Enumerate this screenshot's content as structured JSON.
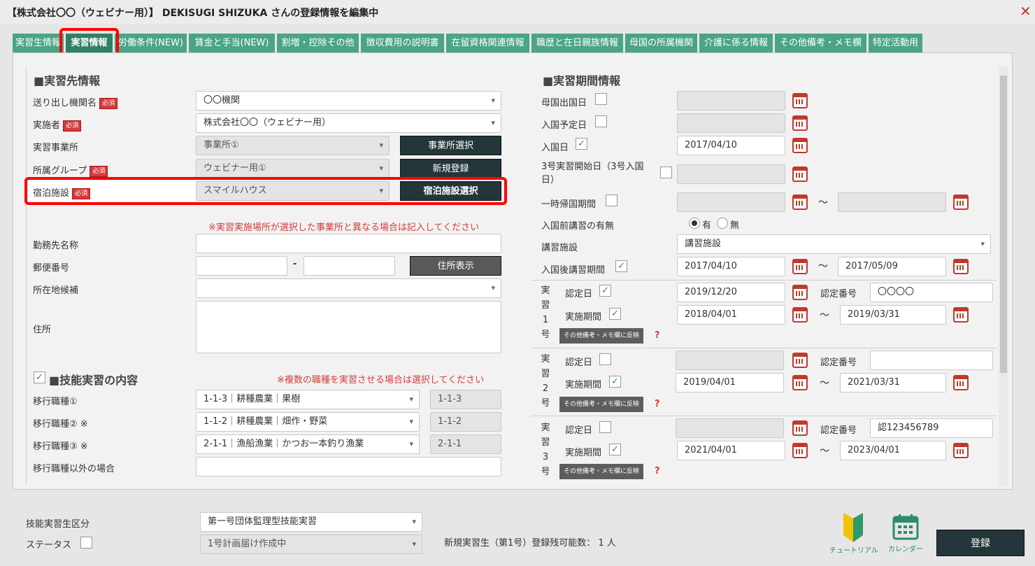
{
  "window": {
    "title": "【株式会社〇〇（ウェビナー用）】 DEKISUGI SHIZUKA さんの登録情報を編集中"
  },
  "tabs": [
    {
      "label": "実習生情報"
    },
    {
      "label": "実習情報"
    },
    {
      "label": "労働条件(NEW)"
    },
    {
      "label": "賃金と手当(NEW)"
    },
    {
      "label": "割増・控除その他"
    },
    {
      "label": "徴収費用の説明書"
    },
    {
      "label": "在留資格関連情報"
    },
    {
      "label": "職歴と在日親族情報"
    },
    {
      "label": "母国の所属機関"
    },
    {
      "label": "介護に係る情報"
    },
    {
      "label": "その他備考・メモ欄"
    },
    {
      "label": "特定活動用"
    }
  ],
  "left": {
    "section_title": "■実習先情報",
    "required_badge": "必須",
    "sending_org": {
      "label": "送り出し機関名",
      "value": "〇〇機関"
    },
    "implementer": {
      "label": "実施者",
      "value": "株式会社〇〇（ウェビナー用）"
    },
    "office": {
      "label": "実習事業所",
      "value": "事業所①",
      "button": "事業所選択"
    },
    "group": {
      "label": "所属グループ",
      "value": "ウェビナー用①",
      "button": "新規登録"
    },
    "lodging": {
      "label": "宿泊施設",
      "value": "スマイルハウス",
      "button": "宿泊施設選択"
    },
    "place_note": "※実習実施場所が選択した事業所と異なる場合は記入してください",
    "workplace": {
      "label": "勤務先名称",
      "value": ""
    },
    "postal": {
      "label": "郵便番号",
      "dash": "-",
      "button": "住所表示"
    },
    "location_candidate": {
      "label": "所在地候補",
      "value": ""
    },
    "address": {
      "label": "住所",
      "value": ""
    },
    "skill_section": "■技能実習の内容",
    "skill_check": "✓",
    "skill_note": "※複数の職種を実習させる場合は選択してください",
    "trans1": {
      "label": "移行職種①",
      "value": "1-1-3｜耕種農業｜果樹",
      "code": "1-1-3"
    },
    "trans2": {
      "label": "移行職種② ※",
      "value": "1-1-2｜耕種農業｜畑作・野菜",
      "code": "1-1-2"
    },
    "trans3": {
      "label": "移行職種③ ※",
      "value": "2-1-1｜漁船漁業｜かつお一本釣り漁業",
      "code": "2-1-1"
    },
    "other": {
      "label": "移行職種以外の場合",
      "value": ""
    }
  },
  "right": {
    "section_title": "■実習期間情報",
    "check": "✓",
    "tilde": "〜",
    "depart": {
      "label": "母国出国日",
      "value": ""
    },
    "planned_entry": {
      "label": "入国予定日",
      "value": ""
    },
    "entry": {
      "label": "入国日",
      "value": "2017/04/10"
    },
    "no3_start": {
      "label": "3号実習開始日（3号入国日）",
      "value": ""
    },
    "temp_return": {
      "label": "一時帰国期間",
      "from": "",
      "to": ""
    },
    "pre_course": {
      "label": "入国前講習の有無",
      "yes": "有",
      "no": "無"
    },
    "course_facility": {
      "label": "講習施設",
      "value": "講習施設"
    },
    "post_course": {
      "label": "入国後講習期間",
      "from": "2017/04/10",
      "to": "2017/05/09"
    },
    "period_labels": {
      "approve_date": "認定日",
      "approve_no": "認定番号",
      "period": "実施期間",
      "reflect": "その他備考・メモ欄に反映",
      "q": "?"
    },
    "p1": {
      "vlabel": [
        "実",
        "習",
        "1",
        "号"
      ],
      "approve_date": "2019/12/20",
      "approve_no": "〇〇〇〇",
      "from": "2018/04/01",
      "to": "2019/03/31"
    },
    "p2": {
      "vlabel": [
        "実",
        "習",
        "2",
        "号"
      ],
      "approve_date": "",
      "approve_no": "",
      "from": "2019/04/01",
      "to": "2021/03/31"
    },
    "p3": {
      "vlabel": [
        "実",
        "習",
        "3",
        "号"
      ],
      "approve_date": "",
      "approve_no": "認123456789",
      "from": "2021/04/01",
      "to": "2023/04/01"
    }
  },
  "footer": {
    "category": {
      "label": "技能実習生区分",
      "value": "第一号団体監理型技能実習"
    },
    "status": {
      "label": "ステータス",
      "value": "1号計画届け作成中"
    },
    "remaining": "新規実習生（第1号）登録残可能数： 1 人",
    "tutorial": "チュートリアル",
    "calendar": "カレンダー",
    "register": "登録"
  }
}
